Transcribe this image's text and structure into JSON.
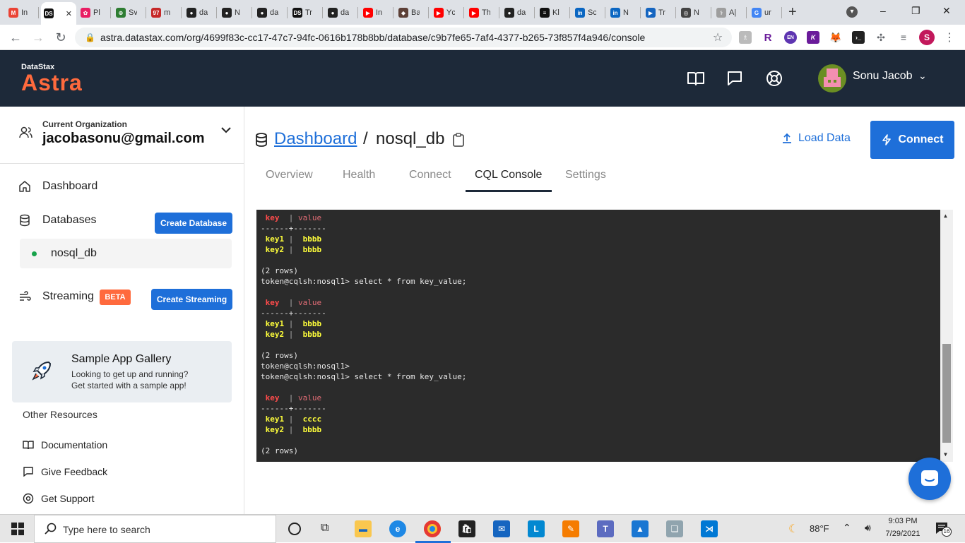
{
  "browser": {
    "tabs": [
      {
        "title": "In",
        "fav": "M",
        "color": "#ea4335"
      },
      {
        "title": "",
        "fav": "DS",
        "color": "#111111",
        "active": true
      },
      {
        "title": "Pl",
        "fav": "✿",
        "color": "#e91e63"
      },
      {
        "title": "Sv",
        "fav": "⊕",
        "color": "#2e7d32"
      },
      {
        "title": "m",
        "fav": "97",
        "color": "#c62828"
      },
      {
        "title": "da",
        "fav": "●",
        "color": "#222222"
      },
      {
        "title": "N",
        "fav": "●",
        "color": "#222222"
      },
      {
        "title": "da",
        "fav": "●",
        "color": "#222222"
      },
      {
        "title": "Tr",
        "fav": "DS",
        "color": "#111111"
      },
      {
        "title": "da",
        "fav": "●",
        "color": "#222222"
      },
      {
        "title": "In",
        "fav": "▶",
        "color": "#ff0000"
      },
      {
        "title": "Ba",
        "fav": "◆",
        "color": "#5d4037"
      },
      {
        "title": "Yc",
        "fav": "▶",
        "color": "#ff0000"
      },
      {
        "title": "Th",
        "fav": "▶",
        "color": "#ff0000"
      },
      {
        "title": "da",
        "fav": "●",
        "color": "#222222"
      },
      {
        "title": "Kl",
        "fav": "≡",
        "color": "#111111"
      },
      {
        "title": "Sc",
        "fav": "in",
        "color": "#0a66c2"
      },
      {
        "title": "N",
        "fav": "in",
        "color": "#0a66c2"
      },
      {
        "title": "Tr",
        "fav": "▶",
        "color": "#1565c0"
      },
      {
        "title": "N",
        "fav": "◎",
        "color": "#444444"
      },
      {
        "title": "A|",
        "fav": "⚕",
        "color": "#9e9e9e"
      },
      {
        "title": "ur",
        "fav": "G",
        "color": "#4285f4"
      }
    ],
    "new_tab": "+",
    "url": "astra.datastax.com/org/4699f83c-cc17-47c7-94fc-0616b178b8bb/database/c9b7fe65-7af4-4377-b265-73f857f4a946/console",
    "profile_initial": "S"
  },
  "header": {
    "brand_small": "DataStax",
    "brand_large": "Astra",
    "user_name": "Sonu Jacob"
  },
  "sidebar": {
    "org_label": "Current Organization",
    "org_name": "jacobasonu@gmail.com",
    "nav": {
      "dashboard": "Dashboard",
      "databases": "Databases",
      "create_database": "Create Database",
      "db_item": "nosql_db",
      "streaming": "Streaming",
      "beta": "BETA",
      "create_streaming": "Create Streaming"
    },
    "gallery": {
      "title": "Sample App Gallery",
      "line1": "Looking to get up and running?",
      "line2": "Get started with a sample app!"
    },
    "other_resources": "Other Resources",
    "resources": {
      "documentation": "Documentation",
      "feedback": "Give Feedback",
      "support": "Get Support"
    }
  },
  "main": {
    "breadcrumb_link": "Dashboard",
    "breadcrumb_sep": "/",
    "db_name": "nosql_db",
    "load_data": "Load Data",
    "connect": "Connect",
    "tabs": {
      "overview": "Overview",
      "health": "Health",
      "connect": "Connect",
      "cql": "CQL Console",
      "settings": "Settings"
    }
  },
  "console": {
    "header_key": "key",
    "header_value": "value",
    "divider": "------+-------",
    "block1": {
      "k1": "key1",
      "v1": "bbbb",
      "k2": "key2",
      "v2": "bbbb"
    },
    "rows_text": "(2 rows)",
    "prompt": "token@cqlsh:nosql1>",
    "cmd": "select * from key_value;",
    "block2": {
      "k1": "key1",
      "v1": "bbbb",
      "k2": "key2",
      "v2": "bbbb"
    },
    "block3": {
      "k1": "key1",
      "v1": "cccc",
      "k2": "key2",
      "v2": "bbbb"
    }
  },
  "taskbar": {
    "search_placeholder": "Type here to search",
    "weather": "88°F",
    "time": "9:03 PM",
    "date": "7/29/2021",
    "notif_count": "16"
  }
}
